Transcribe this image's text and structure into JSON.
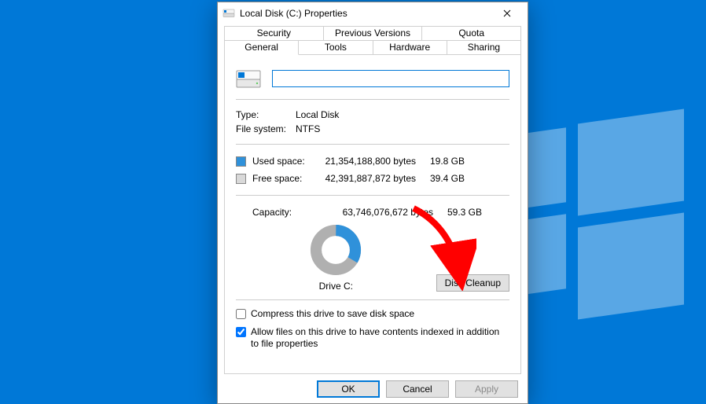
{
  "window": {
    "title": "Local Disk (C:) Properties"
  },
  "tabs": {
    "row1": [
      "Security",
      "Previous Versions",
      "Quota"
    ],
    "row2": [
      "General",
      "Tools",
      "Hardware",
      "Sharing"
    ],
    "active": "General"
  },
  "general": {
    "type_label": "Type:",
    "type_value": "Local Disk",
    "fs_label": "File system:",
    "fs_value": "NTFS",
    "used": {
      "label": "Used space:",
      "bytes": "21,354,188,800 bytes",
      "human": "19.8 GB",
      "color": "#2f91da"
    },
    "free": {
      "label": "Free space:",
      "bytes": "42,391,887,872 bytes",
      "human": "39.4 GB",
      "color": "#b0b0b0"
    },
    "capacity": {
      "label": "Capacity:",
      "bytes": "63,746,076,672 bytes",
      "human": "59.3 GB"
    },
    "drive_label": "Drive C:",
    "cleanup_btn": "Disk Cleanup",
    "compress": "Compress this drive to save disk space",
    "index": "Allow files on this drive to have contents indexed in addition to file properties",
    "compress_checked": false,
    "index_checked": true
  },
  "buttons": {
    "ok": "OK",
    "cancel": "Cancel",
    "apply": "Apply"
  },
  "chart_data": {
    "type": "pie",
    "title": "Drive C:",
    "series": [
      {
        "name": "Used space",
        "value": 21354188800,
        "color": "#2f91da"
      },
      {
        "name": "Free space",
        "value": 42391887872,
        "color": "#b0b0b0"
      }
    ]
  },
  "annotation": {
    "kind": "arrow",
    "target": "disk-cleanup-button",
    "color": "#ff0000"
  }
}
